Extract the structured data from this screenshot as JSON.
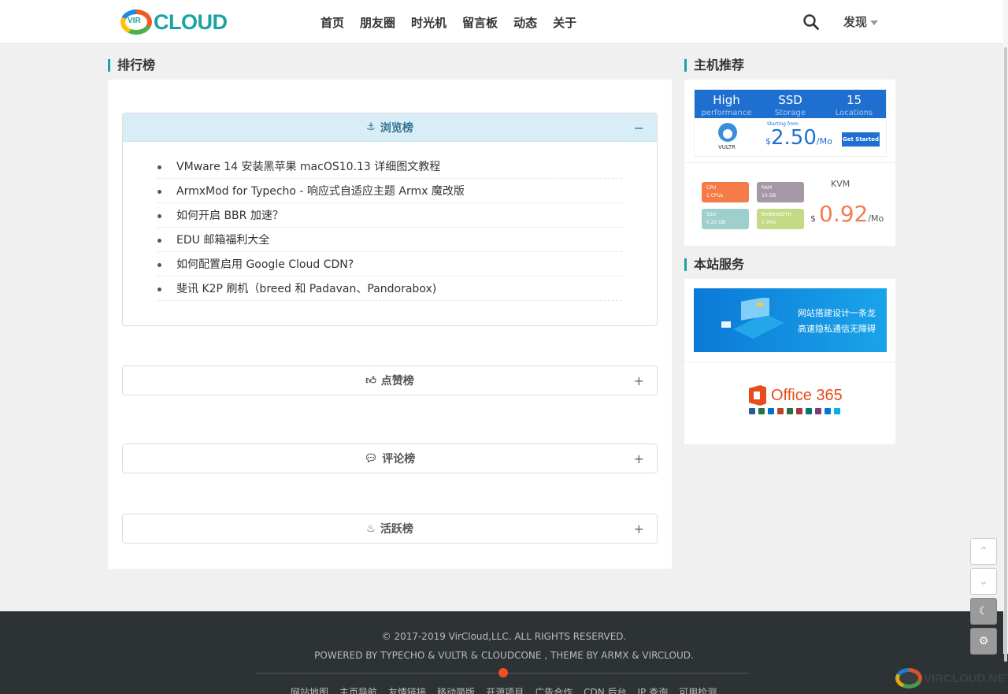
{
  "header": {
    "logo_badge": "VIR",
    "logo_text": "CLOUD",
    "nav": [
      "首页",
      "朋友圈",
      "时光机",
      "留言板",
      "动态",
      "关于"
    ],
    "discover": "发现"
  },
  "main": {
    "title": "排行榜",
    "panels": [
      {
        "label": "浏览榜",
        "icon": "pin-icon",
        "toggle": "−",
        "expanded": true
      },
      {
        "label": "点赞榜",
        "icon": "thumbs-up-icon",
        "toggle": "+",
        "expanded": false
      },
      {
        "label": "评论榜",
        "icon": "comment-icon",
        "toggle": "+",
        "expanded": false
      },
      {
        "label": "活跃榜",
        "icon": "fire-icon",
        "toggle": "+",
        "expanded": false
      }
    ],
    "browse_list": [
      "VMware 14 安装黑苹果 macOS10.13 详细图文教程",
      "ArmxMod for Typecho - 响应式自适应主题 Armx 魔改版",
      "如何开启 BBR 加速？",
      "EDU 邮箱福利大全",
      "如何配置启用 Google Cloud CDN?",
      "斐讯 K2P 刷机（breed 和 Padavan、Pandorabox)"
    ]
  },
  "sidebar": {
    "host_title": "主机推荐",
    "vultr": {
      "cols": [
        {
          "big": "High",
          "small": "performance"
        },
        {
          "big": "SSD",
          "small": "Storage"
        },
        {
          "big": "15",
          "small": "Locations"
        }
      ],
      "brand": "VULTR",
      "starting": "Starting from",
      "dollar": "$",
      "price": "2.50",
      "per": "/Mo",
      "cta": "Get Started"
    },
    "cloudcone": {
      "boxes": [
        {
          "top": "CPU",
          "val": "1 CPUs",
          "color": "#f57b49"
        },
        {
          "top": "RAM",
          "val": "10 GB",
          "color": "#a597a6"
        },
        {
          "top": "SSD",
          "val": "0.25 GB",
          "color": "#9fcfcd"
        },
        {
          "top": "BANDWIDTH",
          "val": "1 VMs",
          "color": "#c5da86"
        }
      ],
      "kvm": "KVM",
      "dollar": "$",
      "price": "0.92",
      "per": "/Mo"
    },
    "service_title": "本站服务",
    "service_line1": "网站搭建设计一条龙",
    "service_line2": "高速隐私通信无障碍",
    "office": "Office 365",
    "accent": "#1ba3a3"
  },
  "footer": {
    "copyright": "© 2017-2019 VirCloud,LLC. ALL RIGHTS RESERVED.",
    "powered": "POWERED BY TYPECHO & VULTR & CLOUDCONE , THEME BY ARMX & VIRCLOUD.",
    "links": [
      "网站地图",
      "主页导航",
      "友情链接",
      "移动简版",
      "开源项目",
      "广告合作",
      "CDN 后台",
      "IP 查询",
      "可用检测"
    ],
    "watermark": "VIRCLOUD.NET"
  }
}
